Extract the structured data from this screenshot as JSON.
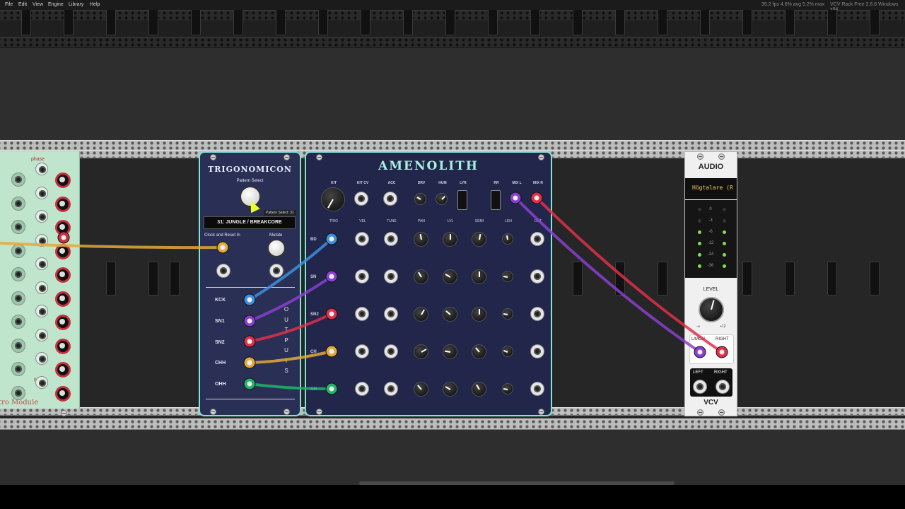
{
  "menubar": {
    "items": [
      "File",
      "Edit",
      "View",
      "Engine",
      "Library",
      "Help"
    ],
    "stats": "35.2 fps  4.6% avg  5.2% max",
    "app_title": "VCV Rack Free 2.6.6 Windows x64"
  },
  "left_module": {
    "label_phase": "phase",
    "label_pause": "pause",
    "brand": "tro Module"
  },
  "trigonomicon": {
    "title": "TRIGONOMICON",
    "pattern_select_label": "Pattern Select",
    "tooltip": "Pattern Select: 31",
    "display_text": "31: JUNGLE / BREAKCORE",
    "clock_reset_label": "Clock and Reset In",
    "mutate_label": "Mutate",
    "outputs_vertical": "OUTPUTS",
    "output_labels": [
      "KCK",
      "SN1",
      "SN2",
      "CHH",
      "OHH"
    ]
  },
  "amenolith": {
    "title": "AMENOLITH",
    "top_labels": [
      "KIT",
      "KIT CV",
      "ACC",
      "DRV",
      "HUM",
      "LYR",
      "RR",
      "MIX L",
      "MIX R"
    ],
    "column_labels": [
      "TRIG",
      "VEL",
      "TUNE",
      "PAN",
      "LVL",
      "SEMI",
      "LEN",
      "OUT"
    ],
    "row_labels": [
      "BD",
      "SN",
      "SN2",
      "CH",
      "OH"
    ]
  },
  "audio": {
    "title": "AUDIO",
    "device": "Högtalare (R",
    "vu_scale": [
      "0",
      "-3",
      "-6",
      "-12",
      "-24",
      "-36"
    ],
    "level_label": "LEVEL",
    "level_min": "-∞",
    "level_max": "+12",
    "in_labels": [
      "L/MON",
      "RIGHT"
    ],
    "out_labels": [
      "LEFT",
      "RIGHT"
    ],
    "brand": "VCV"
  },
  "colors": {
    "trig_panel": "#2a2f55",
    "amen_panel": "#22264a",
    "panel_border": "#7fe6d5",
    "cable_orange": "#e3a93a",
    "cable_blue": "#3d8fe0",
    "cable_purple": "#8a3fd0",
    "cable_red": "#e0304a",
    "cable_green": "#1fb56a",
    "led_green": "#7ee04a"
  }
}
